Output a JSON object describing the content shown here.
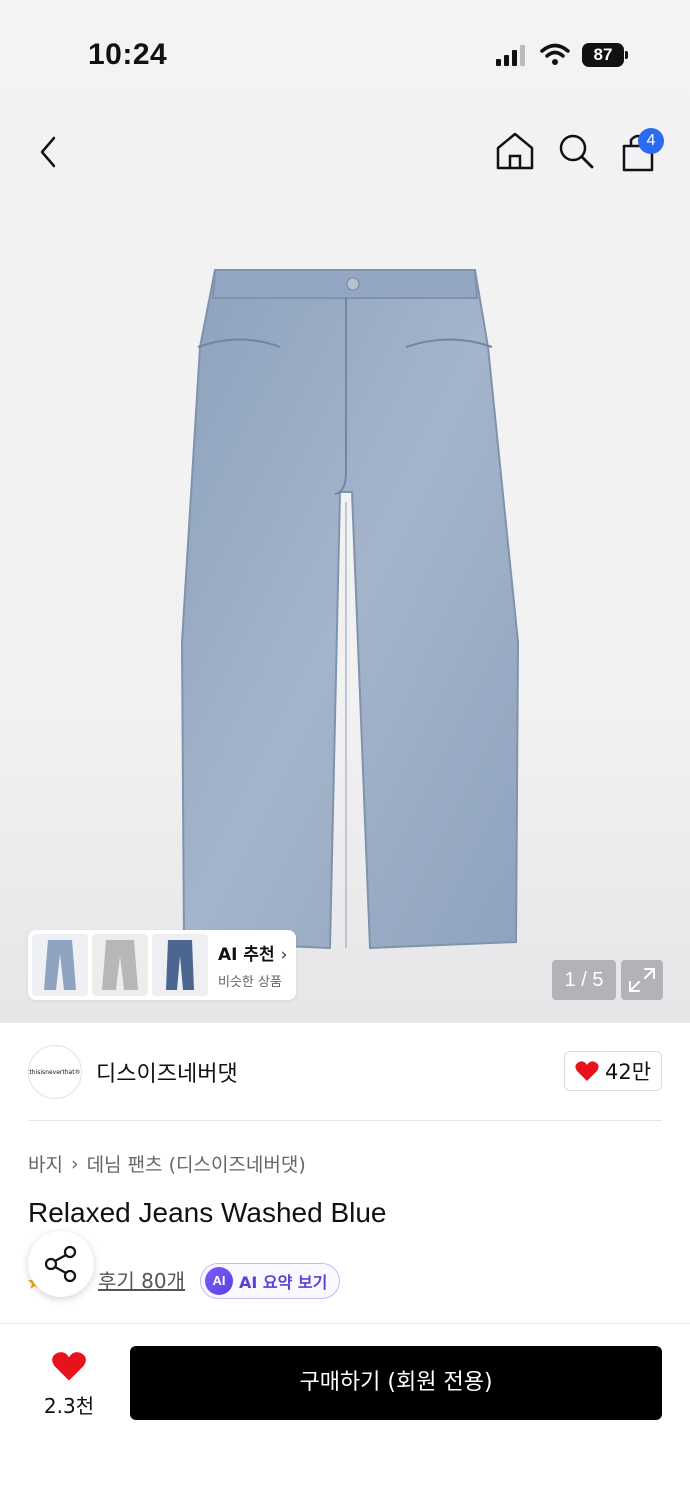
{
  "status_bar": {
    "time": "10:24",
    "battery": "87"
  },
  "nav": {
    "cart_count": "4"
  },
  "gallery": {
    "ai_title": "AI 추천",
    "ai_subtitle": "비슷한 상품",
    "page_indicator": "1 / 5"
  },
  "brand": {
    "name": "디스이즈네버댓",
    "logo_text": "thisisneverthat®",
    "likes": "42만"
  },
  "product": {
    "breadcrumb": [
      "바지",
      "데님 팬츠 (디스이즈네버댓)"
    ],
    "title": "Relaxed Jeans Washed Blue",
    "review_link": "후기 80개",
    "ai_summary_chip": "AI",
    "ai_summary_label": "AI 요약 보기"
  },
  "bottom_bar": {
    "wish_count": "2.3천",
    "buy_label": "구매하기 (회원 전용)"
  },
  "colors": {
    "accent_blue": "#2b6bf0",
    "heart_red": "#e8121c",
    "ai_purple": "#5b3fd8"
  }
}
